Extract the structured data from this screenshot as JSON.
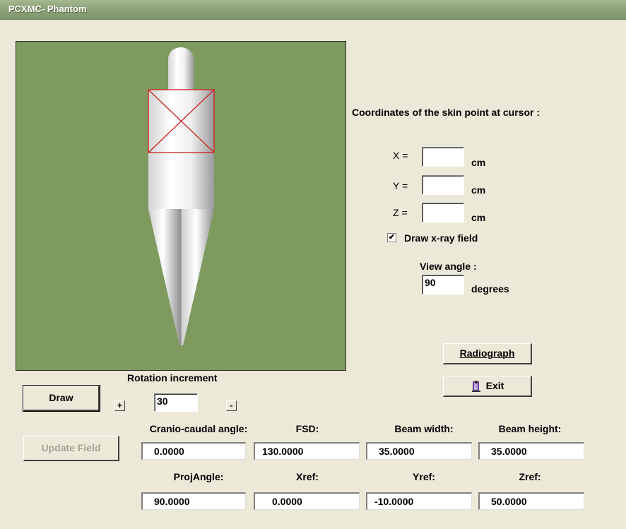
{
  "window": {
    "title": "PCXMC- Phantom"
  },
  "coords": {
    "heading": "Coordinates of the skin point at cursor :",
    "x_label": "X =",
    "y_label": "Y =",
    "z_label": "Z =",
    "unit": "cm",
    "x_value": "",
    "y_value": "",
    "z_value": ""
  },
  "draw_field": {
    "label": "Draw x-ray field",
    "checked": true,
    "check_mark": "✔"
  },
  "view": {
    "label": "View angle :",
    "value": "90",
    "unit": "degrees"
  },
  "buttons": {
    "radiograph": "Radiograph",
    "exit": "Exit",
    "draw": "Draw",
    "update_field": "Update Field",
    "plus": "+",
    "minus": "-"
  },
  "rotation": {
    "label": "Rotation increment",
    "value": "30"
  },
  "params": {
    "cranio_label": "Cranio-caudal angle:",
    "cranio_value": "0.0000",
    "fsd_label": "FSD:",
    "fsd_value": "130.0000",
    "bw_label": "Beam width:",
    "bw_value": "35.0000",
    "bh_label": "Beam height:",
    "bh_value": "35.0000",
    "proj_label": "ProjAngle:",
    "proj_value": "90.0000",
    "xref_label": "Xref:",
    "xref_value": "0.0000",
    "yref_label": "Yref:",
    "yref_value": "-10.0000",
    "zref_label": "Zref:",
    "zref_value": "50.0000"
  },
  "colors": {
    "canvas_bg": "#7e9a5f",
    "field_outline": "#cc1f1f",
    "window_bg": "#ece9d8",
    "titlebar": "#8ea37a"
  }
}
